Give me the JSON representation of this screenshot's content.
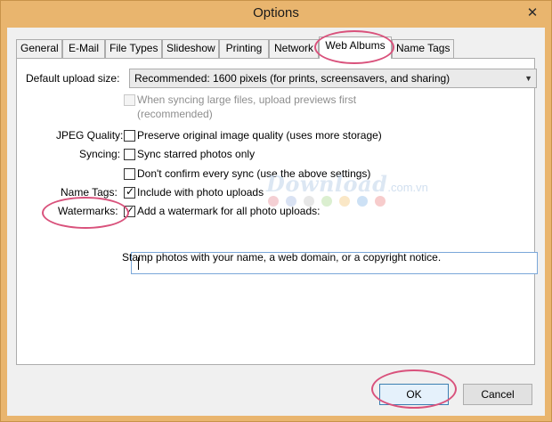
{
  "window": {
    "title": "Options",
    "close_glyph": "✕"
  },
  "tabs": [
    {
      "label": "General",
      "active": false
    },
    {
      "label": "E-Mail",
      "active": false
    },
    {
      "label": "File Types",
      "active": false
    },
    {
      "label": "Slideshow",
      "active": false
    },
    {
      "label": "Printing",
      "active": false
    },
    {
      "label": "Network",
      "active": false
    },
    {
      "label": "Web Albums",
      "active": true
    },
    {
      "label": "Name Tags",
      "active": false
    }
  ],
  "form": {
    "upload_size_label": "Default upload size:",
    "upload_size_value": "Recommended: 1600 pixels (for prints, screensavers, and sharing)",
    "sync_previews_label": "When syncing large files, upload previews first",
    "sync_previews_note": "(recommended)",
    "sync_previews_checked": false,
    "jpeg_label": "JPEG Quality:",
    "jpeg_option": "Preserve original image quality (uses more storage)",
    "jpeg_checked": false,
    "syncing_label": "Syncing:",
    "sync_starred": "Sync starred photos only",
    "sync_starred_checked": false,
    "dont_confirm": "Don't confirm every sync (use the above settings)",
    "dont_confirm_checked": false,
    "name_tags_label": "Name Tags:",
    "name_tags_option": "Include with photo uploads",
    "name_tags_checked": true,
    "watermarks_label": "Watermarks:",
    "watermark_option": "Add a watermark for all photo uploads:",
    "watermark_checked": true,
    "watermark_text_value": "",
    "watermark_hint": "Stamp photos with your name, a web domain, or a copyright notice."
  },
  "buttons": {
    "ok": "OK",
    "cancel": "Cancel"
  },
  "overlay_watermark": {
    "text": "Download",
    "suffix": ".com.vn",
    "dot_colors": [
      "#e9a0a8",
      "#b3c6e7",
      "#d0d0d0",
      "#b7e0a2",
      "#f6d08d",
      "#9cc3ec",
      "#ef9a9a"
    ]
  },
  "colors": {
    "title_bar": "#e9b56e",
    "highlight_ring": "#d9527c",
    "focus_border": "#7aa7d9"
  },
  "check_glyph": "✓",
  "dropdown_glyph": "▼"
}
